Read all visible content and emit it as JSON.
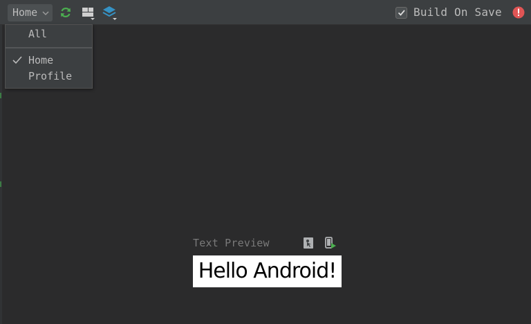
{
  "toolbar": {
    "combo_value": "Home",
    "icons": {
      "refresh": "refresh-icon",
      "layout": "layout-icon",
      "layers": "layers-icon"
    },
    "build_on_save": {
      "label": "Build On Save",
      "checked": true
    },
    "error_icon": "error-icon"
  },
  "dropdown": {
    "items": [
      {
        "label": "All",
        "selected": false
      },
      {
        "label": "Home",
        "selected": true
      },
      {
        "label": "Profile",
        "selected": false
      }
    ]
  },
  "preview": {
    "label": "Text Preview",
    "content": "Hello Android!",
    "icons": {
      "interactive": "interactive-preview-icon",
      "deploy": "deploy-to-device-icon"
    }
  },
  "colors": {
    "background": "#2b2b2c",
    "toolbar": "#3c3f41",
    "refresh_green": "#4caf50",
    "layers_blue": "#3592c4",
    "error_red": "#e05555",
    "text": "#bbbbbb"
  }
}
